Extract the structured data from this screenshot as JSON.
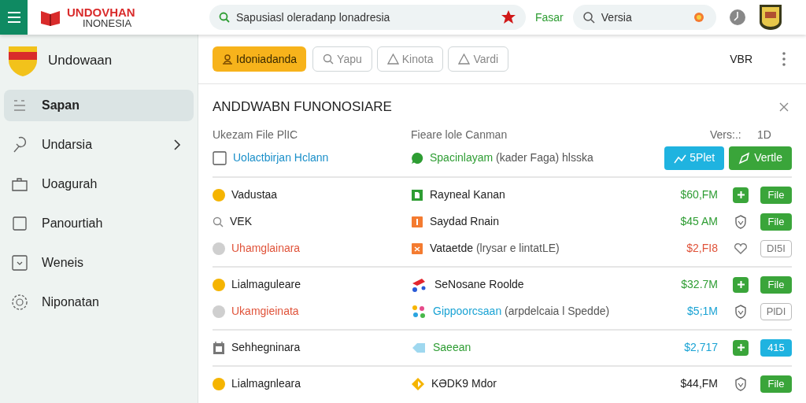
{
  "header": {
    "brand_top": "UNDOVHAN",
    "brand_bottom": "INONESIA",
    "search_value": "Sapusiasl oleradanp lonadresia",
    "link": "Fasar",
    "search2_value": "Versia"
  },
  "sidebar": {
    "title": "Undowaan",
    "items": [
      {
        "label": "Sapan",
        "kind": "lines",
        "selected": true,
        "expandable": false
      },
      {
        "label": "Undarsia",
        "kind": "pin",
        "selected": false,
        "expandable": true
      },
      {
        "label": "Uoagurah",
        "kind": "box",
        "selected": false,
        "expandable": false
      },
      {
        "label": "Panourtiah",
        "kind": "square",
        "selected": false,
        "expandable": false
      },
      {
        "label": "Weneis",
        "kind": "dropdown",
        "selected": false,
        "expandable": false
      },
      {
        "label": "Niponatan",
        "kind": "gear",
        "selected": false,
        "expandable": false
      }
    ]
  },
  "toolbar": {
    "buttons": [
      {
        "label": "Idoniadanda",
        "kind": "person",
        "selected": true
      },
      {
        "label": "Yapu",
        "kind": "search",
        "selected": false
      },
      {
        "label": "Kinota",
        "kind": "triangle",
        "selected": false
      },
      {
        "label": "Vardi",
        "kind": "triangle",
        "selected": false
      }
    ],
    "right_label": "VBR"
  },
  "panel": {
    "title": "ANDDWABN FUNONOSIARE",
    "labels": [
      "Ukezam File PlIC",
      "Fieare lole Canman",
      "Vers:.:",
      "1D"
    ],
    "lead": {
      "kind": "square",
      "text": "Uolactbirjan Hclann",
      "color": "#1a8fc9"
    },
    "middle": {
      "kind": "chat",
      "text": "Spacinlayam",
      "color": "#2e9d33",
      "note": "(kader Faga) hlsska"
    },
    "buttons": [
      {
        "label": "5Plet",
        "kind": "people",
        "color": "#1fb3e0"
      },
      {
        "label": "Vertle",
        "kind": "pen",
        "color": "#3aa53a"
      }
    ],
    "groups": [
      [
        {
          "lead": {
            "kind": "dot",
            "color": "#f5b400"
          },
          "name": {
            "text": "Vadustaa",
            "color": "#222222"
          },
          "detail": {
            "kind": "doc",
            "text": "Rayneal Kanan",
            "color": "#222222"
          },
          "amount": {
            "text": "$60,FM",
            "color": "#2e9d33"
          },
          "action": {
            "kind": "plus"
          },
          "badge": {
            "text": "File",
            "kind": "solid",
            "color": "#3aa53a"
          }
        },
        {
          "lead": {
            "kind": "search"
          },
          "name": {
            "text": "VEK",
            "color": "#222222"
          },
          "detail": {
            "kind": "bar",
            "text": "Saydad Rnain",
            "color": "#222222"
          },
          "amount": {
            "text": "$45 AM",
            "color": "#2e9d33"
          },
          "action": {
            "kind": "shield"
          },
          "badge": {
            "text": "File",
            "kind": "solid",
            "color": "#3aa53a"
          }
        },
        {
          "lead": {
            "kind": "dot",
            "color": "#cfcfcf"
          },
          "name": {
            "text": "Uhamglainara",
            "color": "#e0533a"
          },
          "detail": {
            "kind": "flag",
            "text": "Vataetde",
            "color": "#222222",
            "note": "(lrysar e lintatLE)"
          },
          "amount": {
            "text": "$2,FI8",
            "color": "#e0533a"
          },
          "action": {
            "kind": "heart"
          },
          "badge": {
            "text": "DI5I",
            "kind": "outline"
          }
        }
      ],
      [
        {
          "lead": {
            "kind": "dot",
            "color": "#f5b400"
          },
          "name": {
            "text": "Lialmaguleare",
            "color": "#222222"
          },
          "detail": {
            "kind": "scooter",
            "text": "SeNosane Roolde",
            "color": "#222222"
          },
          "amount": {
            "text": "$32.7M",
            "color": "#2e9d33"
          },
          "action": {
            "kind": "plus"
          },
          "badge": {
            "text": "File",
            "kind": "solid",
            "color": "#3aa53a"
          }
        },
        {
          "lead": {
            "kind": "dot",
            "color": "#cfcfcf"
          },
          "name": {
            "text": "Ukamgieinata",
            "color": "#e0533a"
          },
          "detail": {
            "kind": "sparkle",
            "text": "Gippoorcsaan",
            "color": "#1aa3d4",
            "note": "(arpdelcaia l Spedde)"
          },
          "amount": {
            "text": "$5;1M",
            "color": "#1aa3d4"
          },
          "action": {
            "kind": "shield"
          },
          "badge": {
            "text": "PlDI",
            "kind": "outline"
          }
        }
      ],
      [
        {
          "lead": {
            "kind": "calendar"
          },
          "name": {
            "text": "Sehhegninara",
            "color": "#222222"
          },
          "detail": {
            "kind": "tag",
            "text": "Saeean",
            "color": "#2e9d33"
          },
          "amount": {
            "text": "$2,717",
            "color": "#1aa3d4"
          },
          "action": {
            "kind": "plus"
          },
          "badge": {
            "text": "415",
            "kind": "solid",
            "color": "#1fb3e0"
          }
        }
      ],
      [
        {
          "lead": {
            "kind": "dot",
            "color": "#f5b400"
          },
          "name": {
            "text": "Lialmagnleara",
            "color": "#222222"
          },
          "detail": {
            "kind": "diamond",
            "text": "KƏDK9 Mdor",
            "color": "#222222"
          },
          "amount": {
            "text": "$44,FM",
            "color": "#222222"
          },
          "action": {
            "kind": "shield"
          },
          "badge": {
            "text": "File",
            "kind": "solid",
            "color": "#3aa53a"
          }
        }
      ]
    ]
  }
}
